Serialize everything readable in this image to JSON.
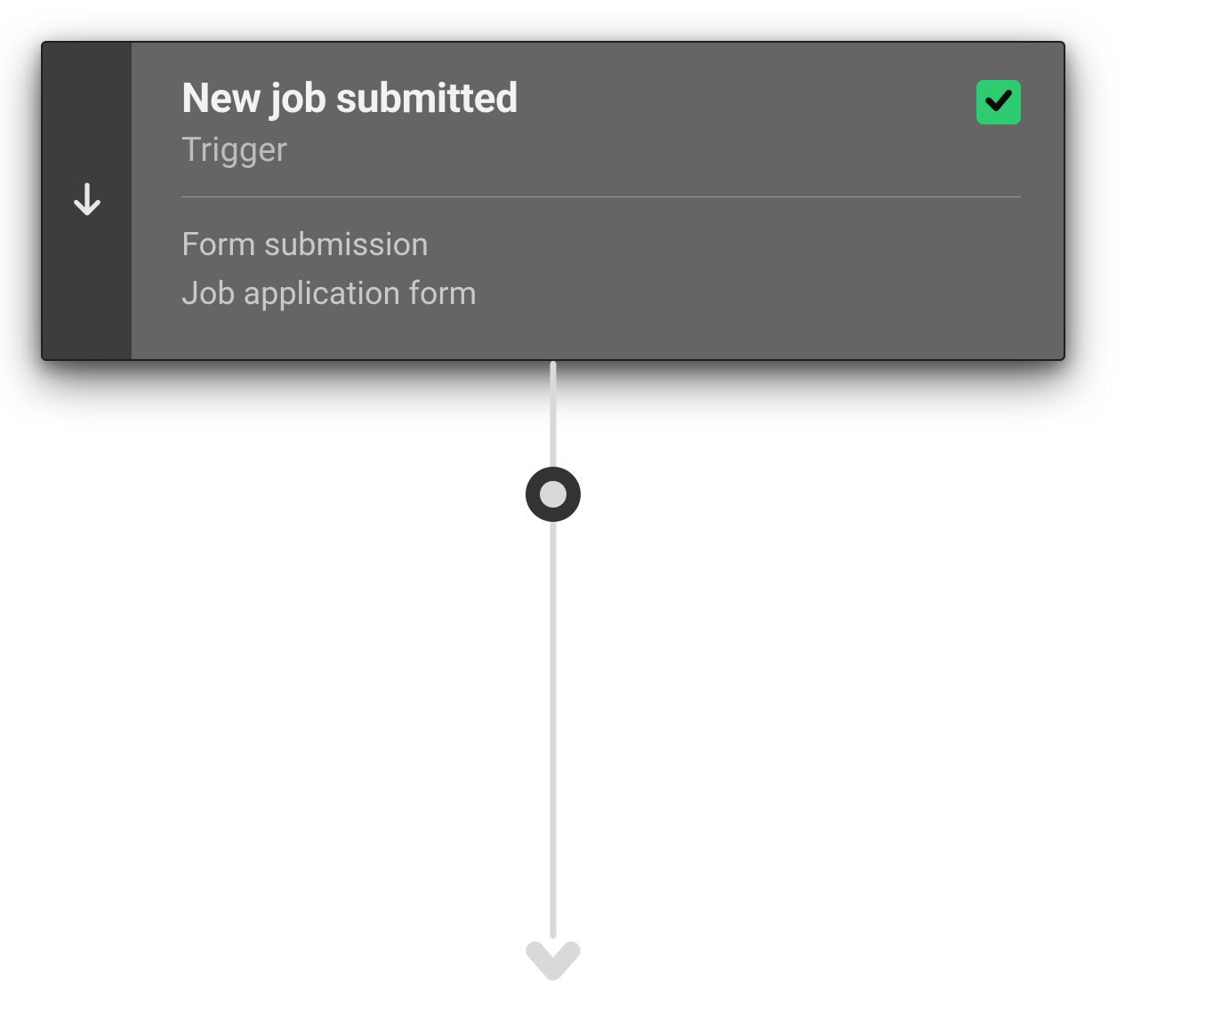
{
  "trigger_card": {
    "title": "New job submitted",
    "subtitle": "Trigger",
    "detail_line1": "Form submission",
    "detail_line2": "Job application form",
    "status": "success"
  },
  "colors": {
    "card_bg": "#656565",
    "spine_bg": "#3d3d3d",
    "success": "#2ecc71",
    "connector": "#d9d9d9",
    "node_bg": "#333333"
  }
}
